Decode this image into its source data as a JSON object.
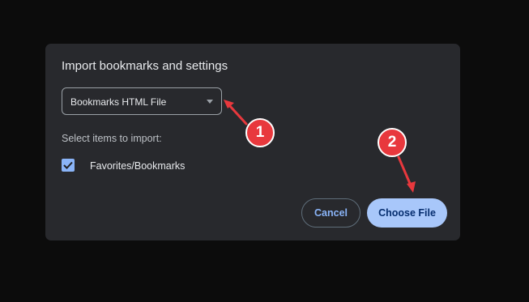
{
  "dialog": {
    "title": "Import bookmarks and settings",
    "source_select": {
      "selected_value": "Bookmarks HTML File"
    },
    "items_label": "Select items to import:",
    "items": [
      {
        "label": "Favorites/Bookmarks",
        "checked": true
      }
    ],
    "buttons": {
      "cancel_label": "Cancel",
      "choose_file_label": "Choose File"
    }
  },
  "annotations": {
    "step_1": "1",
    "step_2": "2",
    "color": "#e8383d"
  },
  "colors": {
    "page_background": "#0c0c0c",
    "dialog_background": "#28292d",
    "accent": "#8ab4f8",
    "primary_button": "#a8c7fa",
    "primary_button_text": "#062e6f"
  }
}
